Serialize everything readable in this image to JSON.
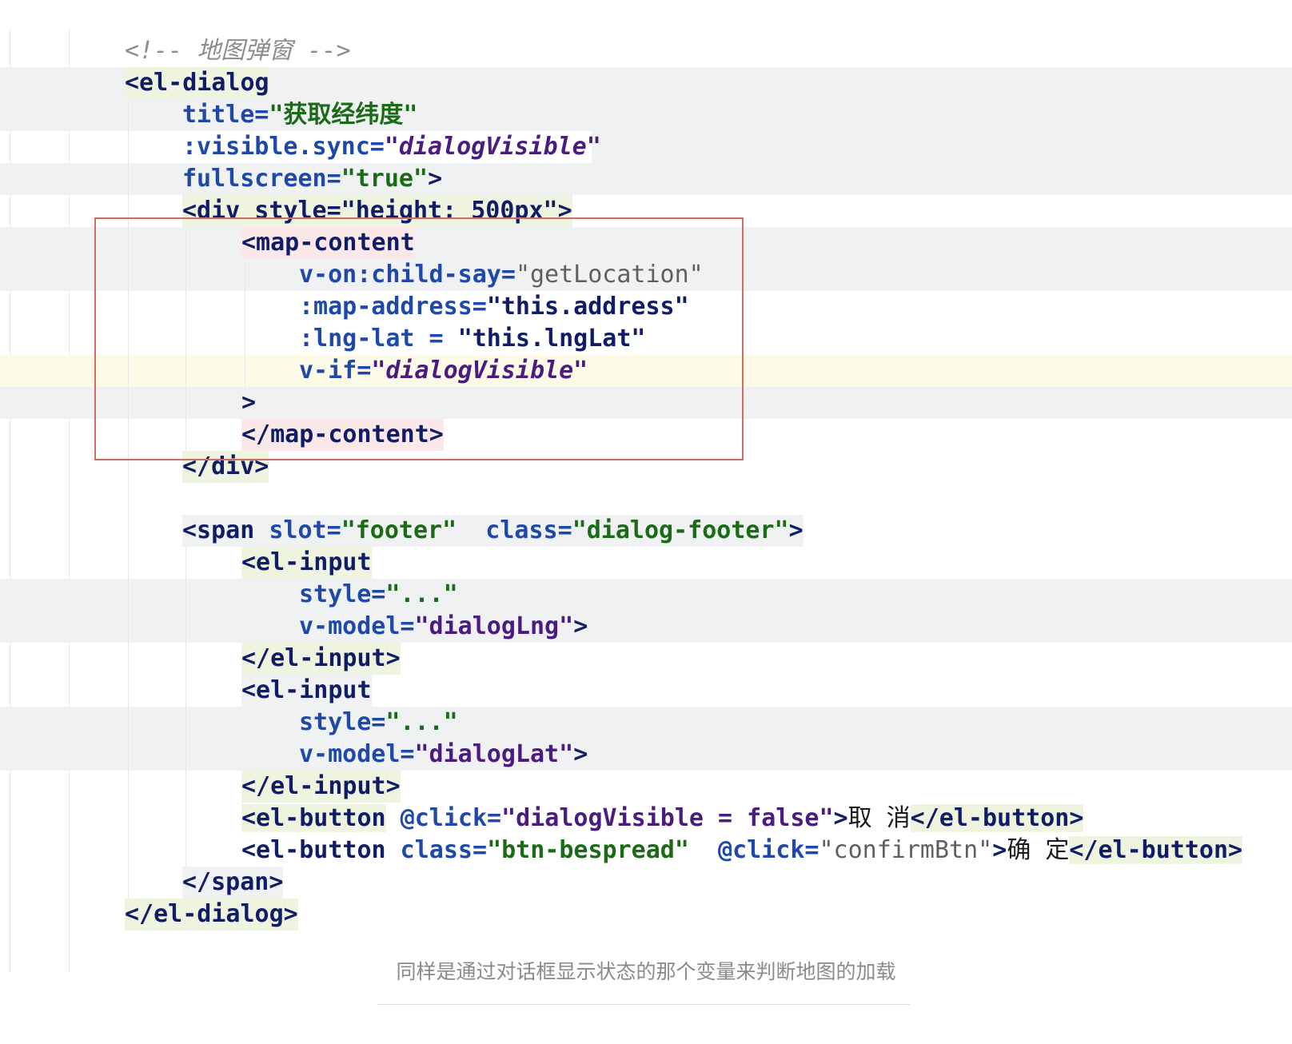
{
  "code": {
    "comment": "<!-- 地图弹窗 -->",
    "l_el_dialog_open": "<el-dialog",
    "l_title_attr": "title=",
    "l_title_val": "\"获取经纬度\"",
    "l_visible_attr": ":visible.sync=",
    "l_visible_val": "\"dialogVisible\"",
    "l_fullscreen_attr": "fullscreen=",
    "l_fullscreen_val": "\"true\"",
    "l_fullscreen_end": ">",
    "l_div_open": "<div style=\"height: 500px\">",
    "l_map_content_open": "<map-content",
    "l_von_attr": "v-on:child-say=",
    "l_von_val": "\"getLocation\"",
    "l_mapaddr_attr": ":map-address=",
    "l_mapaddr_val": "\"this.address\"",
    "l_lnglat_attr": ":lng-lat = ",
    "l_lnglat_val": "\"this.lngLat\"",
    "l_vif_attr": "v-if=",
    "l_vif_val": "\"dialogVisible\"",
    "l_gt": ">",
    "l_map_content_close": "</map-content>",
    "l_div_close": "</div>",
    "l_span_open": "<span",
    "l_slot_attr": " slot=",
    "l_slot_val": "\"footer\"",
    "l_class_attr": "  class=",
    "l_class_val": "\"dialog-footer\"",
    "l_span_open_end": ">",
    "l_el_input_open": "<el-input",
    "l_style_attr": "style=",
    "l_style_val": "\"...\"",
    "l_vmodel_attr": "v-model=",
    "l_vmodel_lng_val": "\"dialogLng\"",
    "l_vmodel_lat_val": "\"dialogLat\"",
    "l_el_input_close": "</el-input>",
    "l_el_button_open": "<el-button",
    "l_click_attr": " @click=",
    "l_click_val_1": "\"dialogVisible = false\"",
    "l_cancel_text": "取 消",
    "l_el_button_close": "</el-button>",
    "l_btn_class_attr": " class=",
    "l_btn_class_val": "\"btn-bespread\"",
    "l_click_attr_2": "  @click=",
    "l_click_val_2": "\"confirmBtn\"",
    "l_confirm_text": "确 定",
    "l_span_close": "</span>",
    "l_el_dialog_close": "</el-dialog>"
  },
  "caption": "同样是通过对话框显示状态的那个变量来判断地图的加载",
  "colors": {
    "tag": "#101d66",
    "attribute": "#1f49a8",
    "string": "#1a6b16",
    "string_italic": "#4b1c80",
    "highlight_border": "#d26b62"
  }
}
